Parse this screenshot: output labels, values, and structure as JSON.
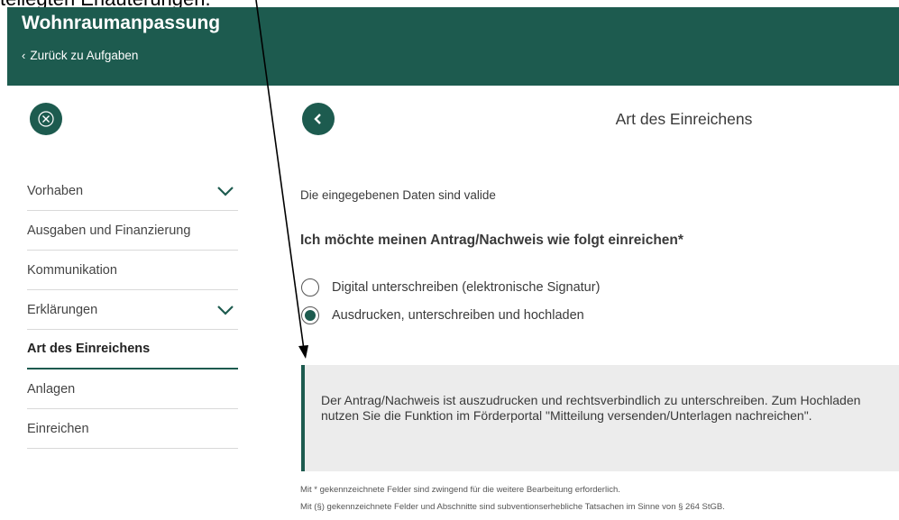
{
  "cropped_caption": "tellegten Erläuterungen.",
  "header": {
    "title": "Wohnraumanpassung",
    "back_label": "Zurück zu Aufgaben"
  },
  "sidebar": {
    "items": [
      {
        "label": "Vorhaben",
        "expandable": true
      },
      {
        "label": "Ausgaben und Finanzierung",
        "expandable": false
      },
      {
        "label": "Kommunikation",
        "expandable": false
      },
      {
        "label": "Erklärungen",
        "expandable": true
      },
      {
        "label": "Art des Einreichens",
        "expandable": false,
        "active": true
      },
      {
        "label": "Anlagen",
        "expandable": false
      },
      {
        "label": "Einreichen",
        "expandable": false
      }
    ]
  },
  "main": {
    "title": "Art des Einreichens",
    "valid_message": "Die eingegebenen Daten sind valide",
    "question": "Ich möchte meinen Antrag/Nachweis wie folgt einreichen*",
    "options": [
      {
        "label": "Digital unterschreiben (elektronische Signatur)",
        "selected": false
      },
      {
        "label": "Ausdrucken, unterschreiben und hochladen",
        "selected": true
      }
    ],
    "info_text": "Der Antrag/Nachweis ist auszudrucken und rechtsverbindlich zu unterschreiben. Zum Hochladen nutzen Sie die Funktion im Förderportal \"Mitteilung versenden/Unterlagen nachreichen\".",
    "footnotes": [
      "Mit * gekennzeichnete Felder sind zwingend für die weitere Bearbeitung erforderlich.",
      "Mit (§) gekennzeichnete Felder und Abschnitte sind subventionserhebliche Tatsachen im Sinne von § 264 StGB."
    ]
  },
  "colors": {
    "brand": "#1d5b4f",
    "info_bg": "#ececec"
  },
  "icons": {
    "close": "close-icon",
    "back": "chevron-left-icon",
    "expand": "chevron-down-icon"
  }
}
